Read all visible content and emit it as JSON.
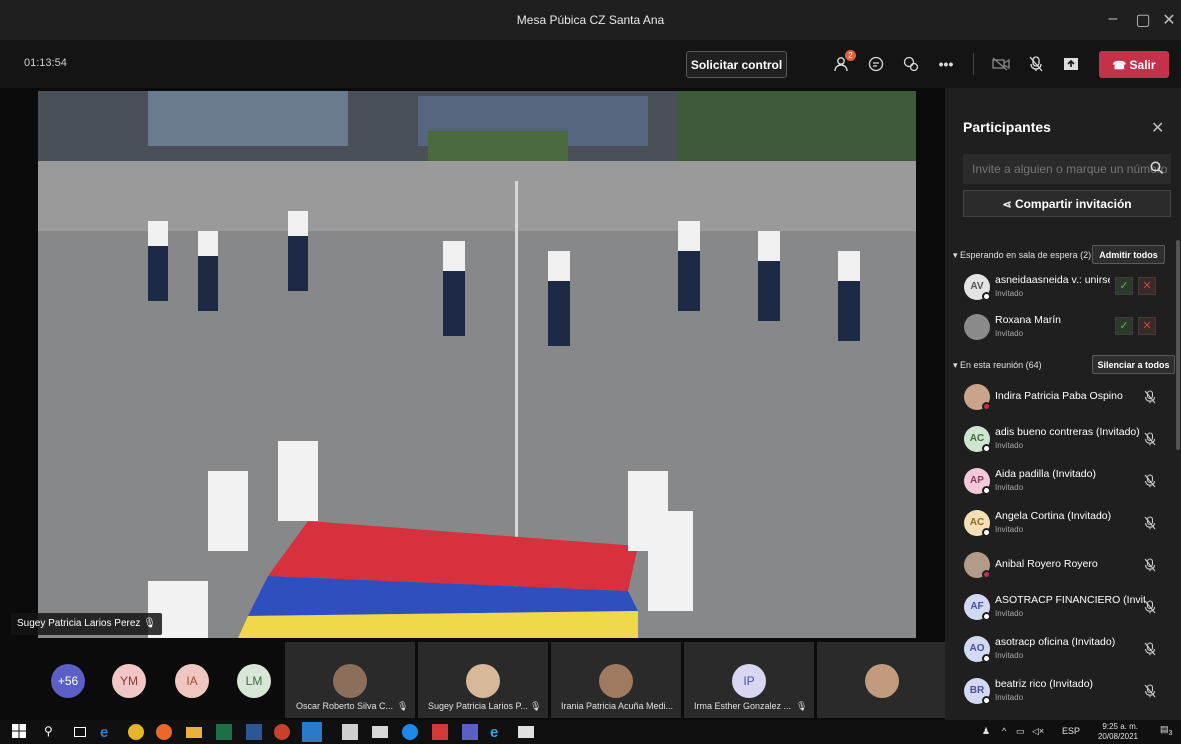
{
  "window": {
    "title": "Mesa Púbica CZ Santa Ana"
  },
  "toolbar": {
    "timer": "01:13:54",
    "request_control": "Solicitar control",
    "people_badge": "2",
    "leave": "Salir"
  },
  "video": {
    "speaker_name": "Sugey Patricia Larios Perez"
  },
  "gallery": [
    {
      "initials": "+56",
      "color": "#5b5fc7"
    },
    {
      "initials": "YM",
      "color": "#f1c6c6"
    },
    {
      "initials": "IA",
      "color": "#f0c7c0"
    },
    {
      "initials": "LM",
      "color": "#d7e6d7"
    },
    {
      "name": "Oscar Roberto Silva C..."
    },
    {
      "name": "Sugey Patricia Larios P..."
    },
    {
      "name": "Irania Patricia Acuña Medi..."
    },
    {
      "name": "Irma Esther Gonzalez ...",
      "initials": "IP",
      "color": "#d7d7f2"
    },
    {
      "name": ""
    }
  ],
  "participants": {
    "title": "Participantes",
    "search_placeholder": "Invite a alguien o marque un número",
    "share": "Compartir invitación",
    "waiting_label": "Esperando en sala de espera (2)",
    "admit_all": "Admitir todos",
    "waiting": [
      {
        "initials": "AV",
        "name": "asneidaasneida v.: unirse...",
        "sub": "Invitado",
        "color": "#e3e3e3"
      },
      {
        "initials": "",
        "name": "Roxana Marín",
        "sub": "Invitado",
        "color": "#8a8a8a"
      }
    ],
    "meeting_label": "En esta reunión (64)",
    "mute_all": "Silenciar a todos",
    "members": [
      {
        "initials": "",
        "name": "Indira Patricia Paba Ospino",
        "sub": "",
        "color": "#c9a48a"
      },
      {
        "initials": "AC",
        "name": "adis bueno contreras (Invitado)",
        "sub": "Invitado",
        "color": "#cfe5cf"
      },
      {
        "initials": "AP",
        "name": "Aida padilla (Invitado)",
        "sub": "Invitado",
        "color": "#f3c9d9"
      },
      {
        "initials": "AC",
        "name": "Angela Cortina (Invitado)",
        "sub": "Invitado",
        "color": "#f4dfb5"
      },
      {
        "initials": "",
        "name": "Anibal Royero Royero",
        "sub": "",
        "color": "#b49a88"
      },
      {
        "initials": "AF",
        "name": "ASOTRACP FINANCIERO (Invit...",
        "sub": "Invitado",
        "color": "#d4d9f2"
      },
      {
        "initials": "AO",
        "name": "asotracp oficina (Invitado)",
        "sub": "Invitado",
        "color": "#d4d9f2"
      },
      {
        "initials": "BR",
        "name": "beatriz rico (Invitado)",
        "sub": "Invitado",
        "color": "#d4d9f2"
      }
    ]
  },
  "taskbar": {
    "lang": "ESP",
    "time": "9:25 a. m.",
    "date": "20/08/2021",
    "notif_count": "3"
  }
}
